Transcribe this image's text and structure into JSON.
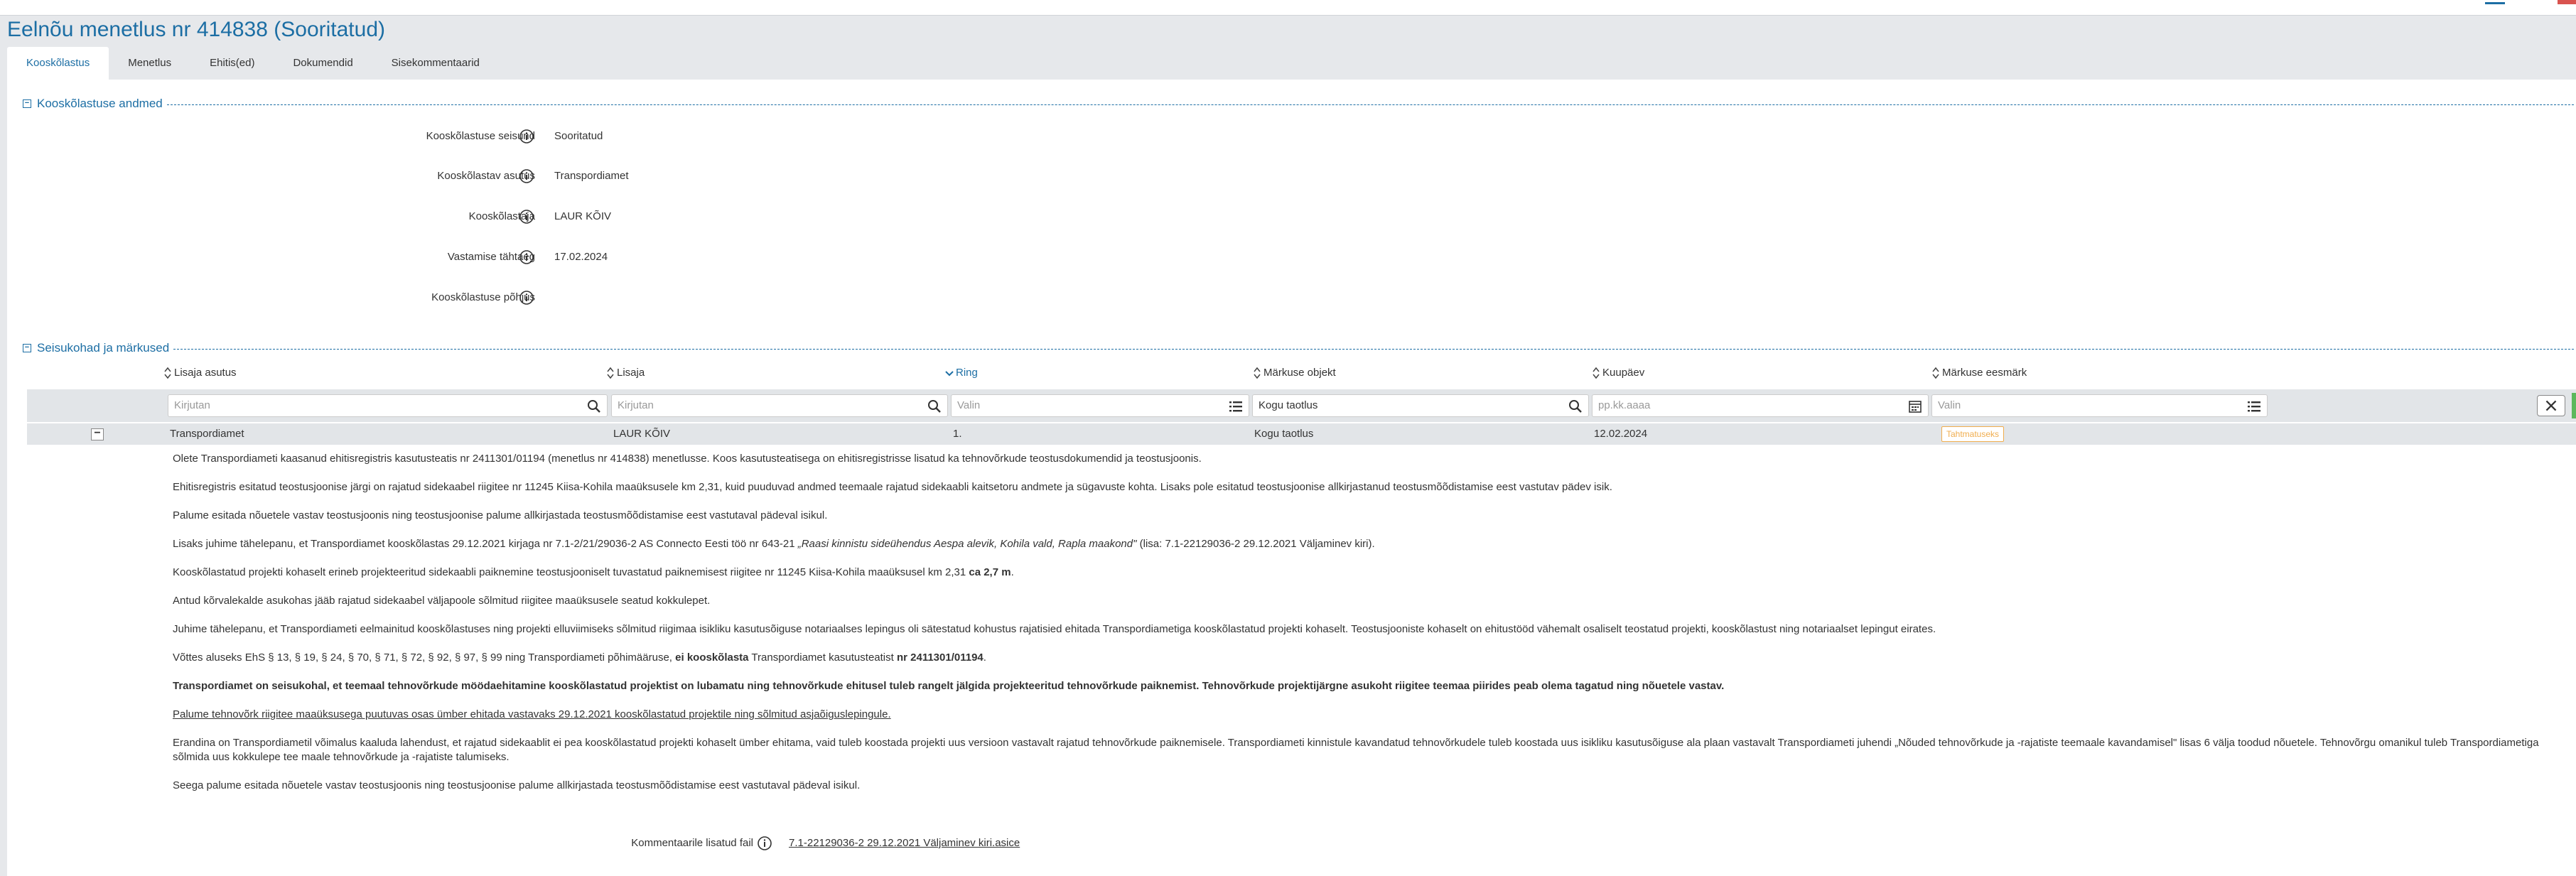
{
  "page": {
    "title": "Eelnõu menetlus nr 414838 (Sooritatud)"
  },
  "tabs": [
    {
      "label": "Kooskõlastus"
    },
    {
      "label": "Menetlus"
    },
    {
      "label": "Ehitis(ed)"
    },
    {
      "label": "Dokumendid"
    },
    {
      "label": "Sisekommentaarid"
    }
  ],
  "section1": {
    "title": "Kooskõlastuse andmed",
    "fields": [
      {
        "label": "Kooskõlastuse seisund",
        "value": "Sooritatud"
      },
      {
        "label": "Kooskõlastav asutus",
        "value": "Transpordiamet"
      },
      {
        "label": "Kooskõlastaja",
        "value": "LAUR KÕIV"
      },
      {
        "label": "Vastamise tähtaeg",
        "value": "17.02.2024"
      },
      {
        "label": "Kooskõlastuse põhjus",
        "value": ""
      }
    ]
  },
  "section2": {
    "title": "Seisukohad ja märkused",
    "columns": [
      {
        "label": "Lisaja asutus"
      },
      {
        "label": "Lisaja"
      },
      {
        "label": "Ring"
      },
      {
        "label": "Märkuse objekt"
      },
      {
        "label": "Kuupäev"
      },
      {
        "label": "Märkuse eesmärk"
      }
    ],
    "filters": {
      "lisaja_asutus": {
        "placeholder": "Kirjutan"
      },
      "lisaja": {
        "placeholder": "Kirjutan"
      },
      "ring": {
        "placeholder": "Valin"
      },
      "markuse_objekt": {
        "value": "Kogu taotlus"
      },
      "kuupaev": {
        "placeholder": "pp.kk.aaaa"
      },
      "markuse_eesmark": {
        "placeholder": "Valin"
      }
    },
    "row": {
      "lisaja_asutus": "Transpordiamet",
      "lisaja": "LAUR KÕIV",
      "ring": "1.",
      "markuse_objekt": "Kogu taotlus",
      "kuupaev": "12.02.2024",
      "markuse_eesmark": "Tahtmatuseks"
    },
    "comment": {
      "p1": "Olete Transpordiameti kaasanud ehitisregistris kasutusteatis nr 2411301/01194 (menetlus nr 414838) menetlusse. Koos kasutusteatisega on ehitisregistrisse lisatud ka tehnovõrkude teostusdokumendid ja teostusjoonis.",
      "p2": "Ehitisregistris esitatud teostusjoonise järgi on rajatud sidekaabel riigitee nr 11245 Kiisa-Kohila maaüksusele km 2,31, kuid puuduvad andmed teemaale rajatud sidekaabli kaitsetoru andmete ja sügavuste kohta. Lisaks pole esitatud teostusjoonise allkirjastanud teostusmõõdistamise eest vastutav pädev isik.",
      "p3": "Palume esitada nõuetele vastav teostusjoonis ning teostusjoonise palume allkirjastada teostusmõõdistamise eest vastutaval pädeval isikul.",
      "p4a": "Lisaks juhime tähelepanu, et Transpordiamet kooskõlastas 29.12.2021 kirjaga nr 7.1-2/21/29036-2 AS Connecto Eesti töö nr 643-21 ",
      "p4b": "„Raasi kinnistu sideühendus Aespa alevik, Kohila vald, Rapla maakond\"",
      "p4c": " (lisa: 7.1-22129036-2 29.12.2021 Väljaminev kiri).",
      "p5a": "Kooskõlastatud projekti kohaselt erineb projekteeritud sidekaabli paiknemine teostusjooniselt tuvastatud paiknemisest riigitee nr 11245 Kiisa-Kohila maaüksusel km 2,31 ",
      "p5b": "ca 2,7 m",
      "p5c": ".",
      "p6": "Antud kõrvalekalde asukohas jääb rajatud sidekaabel väljapoole sõlmitud riigitee maaüksusele seatud kokkulepet.",
      "p7": "Juhime tähelepanu, et Transpordiameti eelmainitud kooskõlastuses ning projekti elluviimiseks sõlmitud riigimaa isikliku kasutusõiguse notariaalses lepingus oli sätestatud kohustus rajatisied ehitada Transpordiametiga kooskõlastatud projekti kohaselt. Teostusjooniste kohaselt on ehitustööd vähemalt osaliselt teostatud projekti, kooskõlastust ning notariaalset lepingut eirates.",
      "p8a": "Võttes aluseks EhS § 13, § 19, § 24, § 70, § 71, § 72, § 92, § 97, § 99 ning Transpordiameti põhimääruse, ",
      "p8b": "ei kooskõlasta",
      "p8c": " Transpordiamet kasutusteatist ",
      "p8d": "nr 2411301/01194",
      "p8e": ".",
      "p9": "Transpordiamet on seisukohal, et teemaal tehnovõrkude mööda­ehitamine kooskõlastatud projektist on lubamatu ning tehnovõrkude ehitusel tuleb rangelt jälgida projekteeritud tehnovõrkude paiknemist. Tehnovõrkude projektijärgne asukoht riigitee teemaa piirides peab olema tagatud ning nõuetele vastav.",
      "p10": "Palume tehnovõrk riigitee maaüksusega puutuvas osas ümber ehitada vastavaks 29.12.2021 kooskõlastatud projektile ning sõlmitud asjaõiguslepingule.",
      "p11": "Erandina on Transpordiametil võimalus kaaluda lahendust, et rajatud sidekaablit ei pea kooskõlastatud projekti kohaselt ümber ehitama, vaid tuleb koostada projekti uus versioon vastavalt rajatud tehnovõrkude paiknemisele. Transpordiameti kinnistule kavandatud tehnovõrkudele tuleb koostada uus isikliku kasutusõiguse ala plaan vastavalt Transpordiameti juhendi „Nõuded tehnovõrkude ja -rajatiste teemaale kavandamisel\" lisas 6 välja toodud nõuetele. Tehnovõrgu omanikul tuleb Transpordiametiga sõlmida uus kokkulepe tee maale tehnovõrkude ja -rajatiste talumiseks.",
      "p12": "Seega palume esitada nõuetele vastav teostusjoonis ning teostusjoonise palume allkirjastada teostusmõõdistamise eest vastutaval pädeval isikul."
    },
    "attachment": {
      "label": "Kommentaarile lisatud fail",
      "file": "7.1-22129036-2 29.12.2021 Väljaminev kiri.asice"
    }
  },
  "colors": {
    "accent": "#1c6ea4",
    "badge": "#f0ad4e",
    "rowbg": "#e2e5e8"
  }
}
